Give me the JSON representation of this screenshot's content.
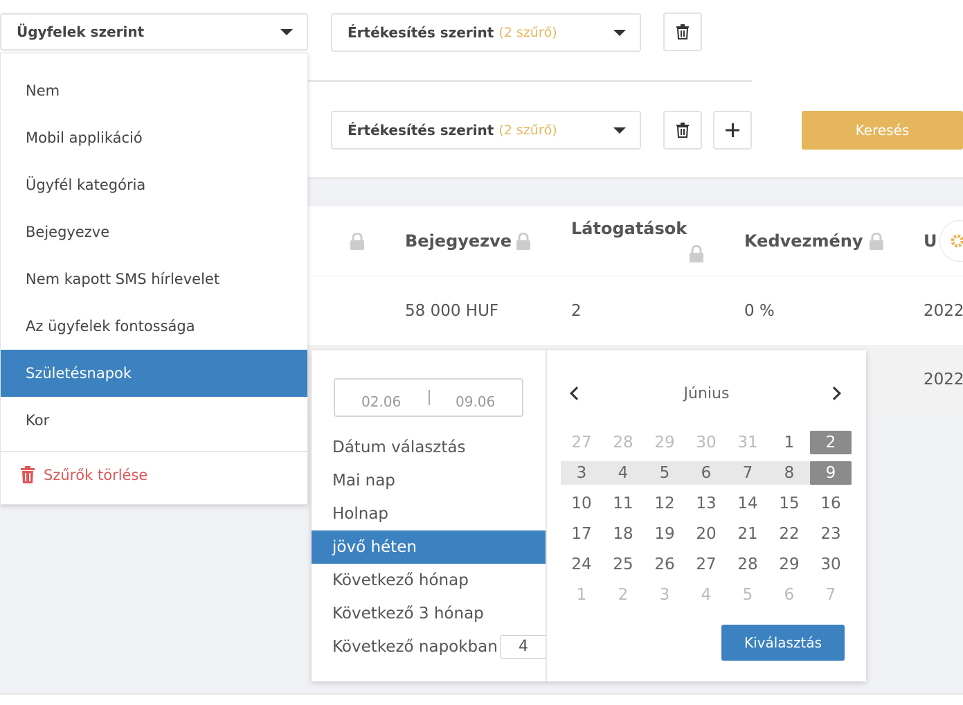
{
  "filters": {
    "customer_select": {
      "label": "Ügyfelek szerint"
    },
    "sales_select_1": {
      "label": "Értékesítés szerint",
      "count": "(2 szűrő)"
    },
    "sales_select_2": {
      "label": "Értékesítés szerint",
      "count": "(2 szűrő)"
    },
    "search_label": "Keresés"
  },
  "menu": {
    "items": [
      {
        "label": "Nem"
      },
      {
        "label": "Mobil applikáció"
      },
      {
        "label": "Ügyfél kategória"
      },
      {
        "label": "Bejegyezve"
      },
      {
        "label": "Nem kapott SMS hírlevelet"
      },
      {
        "label": "Az ügyfelek fontossága"
      },
      {
        "label": "Születésnapok"
      },
      {
        "label": "Kor"
      }
    ],
    "active_item": "Születésnapok",
    "clear_label": "Szűrők törlése"
  },
  "table": {
    "headers": [
      "Bejegyezve",
      "Látogatások",
      "Kedvezmény",
      "U"
    ],
    "row1": [
      "58 000 HUF",
      "2",
      "0 %",
      "2022"
    ],
    "row2": [
      "2022"
    ]
  },
  "picker": {
    "range_from": "02.06",
    "range_to": "09.06",
    "options": [
      "Dátum választás",
      "Mai nap",
      "Holnap",
      "jövő héten",
      "Következő hónap",
      "Következő 3 hónap",
      "Következő napokban"
    ],
    "active_option": "jövő héten",
    "days_value": "4",
    "month": "Június",
    "weeks": [
      [
        "27",
        "28",
        "29",
        "30",
        "31",
        "1",
        "2"
      ],
      [
        "3",
        "4",
        "5",
        "6",
        "7",
        "8",
        "9"
      ],
      [
        "10",
        "11",
        "12",
        "13",
        "14",
        "15",
        "16"
      ],
      [
        "17",
        "18",
        "19",
        "20",
        "21",
        "22",
        "23"
      ],
      [
        "24",
        "25",
        "26",
        "27",
        "28",
        "29",
        "30"
      ],
      [
        "1",
        "2",
        "3",
        "4",
        "5",
        "6",
        "7"
      ]
    ],
    "confirm_label": "Kiválasztás"
  },
  "colors": {
    "accent_blue": "#3d82c0",
    "accent_gold": "#e6b65c",
    "danger": "#e05757"
  }
}
